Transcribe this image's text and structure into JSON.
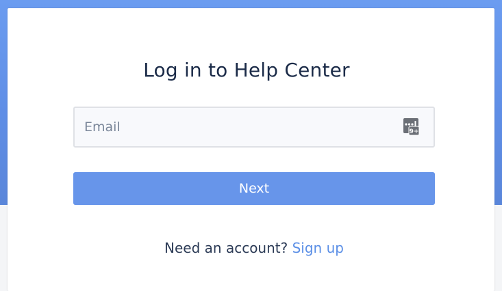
{
  "page": {
    "title": "Log in to Help Center"
  },
  "email_field": {
    "value": "",
    "placeholder": "Email"
  },
  "password_manager_icon": {
    "icon": "password-manager-icon",
    "badge_text": "9+"
  },
  "next_button": {
    "label": "Next"
  },
  "signup": {
    "prompt": "Need an account?",
    "link_label": "Sign up"
  },
  "colors": {
    "accent": "#6795ea",
    "link": "#5b8fe6",
    "title_text": "#1b2b48",
    "backdrop": "#5f8ee6"
  }
}
